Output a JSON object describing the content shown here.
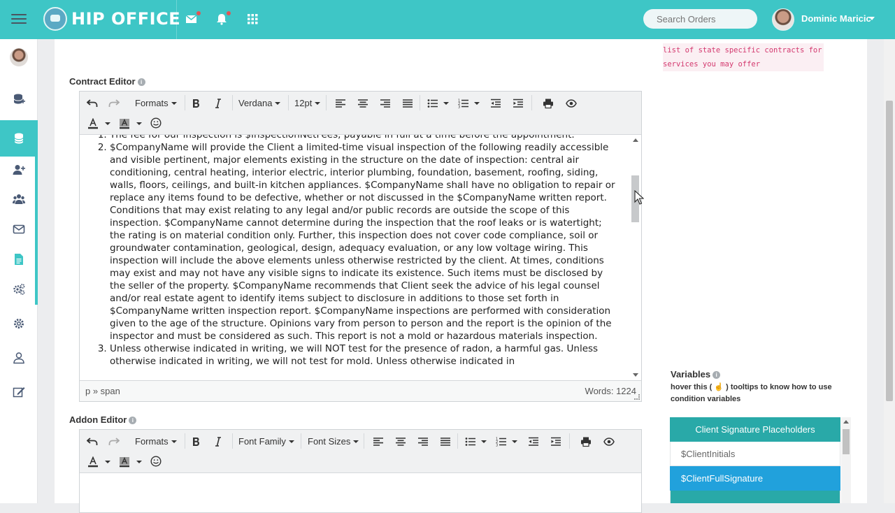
{
  "app": {
    "brand": "HIP OFFICE",
    "search_placeholder": "Search Orders",
    "user_name": "Dominic Maricic"
  },
  "sidebar": {
    "items": [
      "add-database-icon",
      "database-icon",
      "add-user-icon",
      "users-icon",
      "mail-icon",
      "document-icon",
      "cogs-icon",
      "gear-icon",
      "user-icon",
      "edit-icon"
    ]
  },
  "contract_editor": {
    "label": "Contract Editor",
    "toolbar": {
      "formats": "Formats",
      "font": "Verdana",
      "size": "12pt"
    },
    "partial_first_line": "The fee for our inspection is $InspectionNetFees, payable in full at a time before the appointment.",
    "items": [
      "$CompanyName will provide the Client a limited-time visual inspection of the following readily accessible and visible pertinent, major elements existing in the structure on the date of inspection: central air conditioning, central heating, interior electric, interior plumbing, foundation, basement, roofing, siding, walls, floors, ceilings, and built-in kitchen appliances. $CompanyName shall have no obligation to repair or replace any items found to be defective, whether or not discussed in the $CompanyName written report. Conditions that may exist relating to any legal and/or public records are outside the scope of this inspection. $CompanyName cannot determine during the inspection that the roof leaks or is watertight; the rating is on material condition only. Further, this inspection does not cover code compliance, soil or groundwater contamination, geological, design, adequacy evaluation, or any low voltage wiring. This inspection will include the above elements unless otherwise restricted by the client. At times, conditions may exist and may not have any visible signs to indicate its existence. Such items must be disclosed by the seller of the property. $CompanyName recommends that Client seek the advice of his legal counsel and/or real estate agent to identify items subject to disclosure in additions to those set forth in $CompanyName written inspection report. $CompanyName inspections are performed with consideration given to the age of the structure. Opinions vary from person to person and the report is the opinion of the inspector and must be considered as such. This report is not a mold or hazardous materials inspection.",
      "Unless otherwise indicated in writing, we will NOT test for the presence of radon, a harmful gas.  Unless otherwise indicated in writing, we will not test for mold. Unless otherwise indicated in"
    ],
    "status_path": "p » span",
    "word_count": "Words: 1224"
  },
  "addon_editor": {
    "label": "Addon Editor",
    "toolbar": {
      "formats": "Formats",
      "font": "Font Family",
      "size": "Font Sizes"
    }
  },
  "hint_text": "list of state specific contracts for services you may offer",
  "variables": {
    "title": "Variables",
    "help": "hover this ( ☝ ) tooltips to know how to use condition variables",
    "panel_title": "Client Signature Placeholders",
    "items": [
      "$ClientInitials",
      "$ClientFullSignature"
    ]
  },
  "colors": {
    "primary": "#3ec6c6",
    "panel_header": "#29a9a8",
    "selected": "#21a1dc",
    "hint": "#d3386e"
  }
}
